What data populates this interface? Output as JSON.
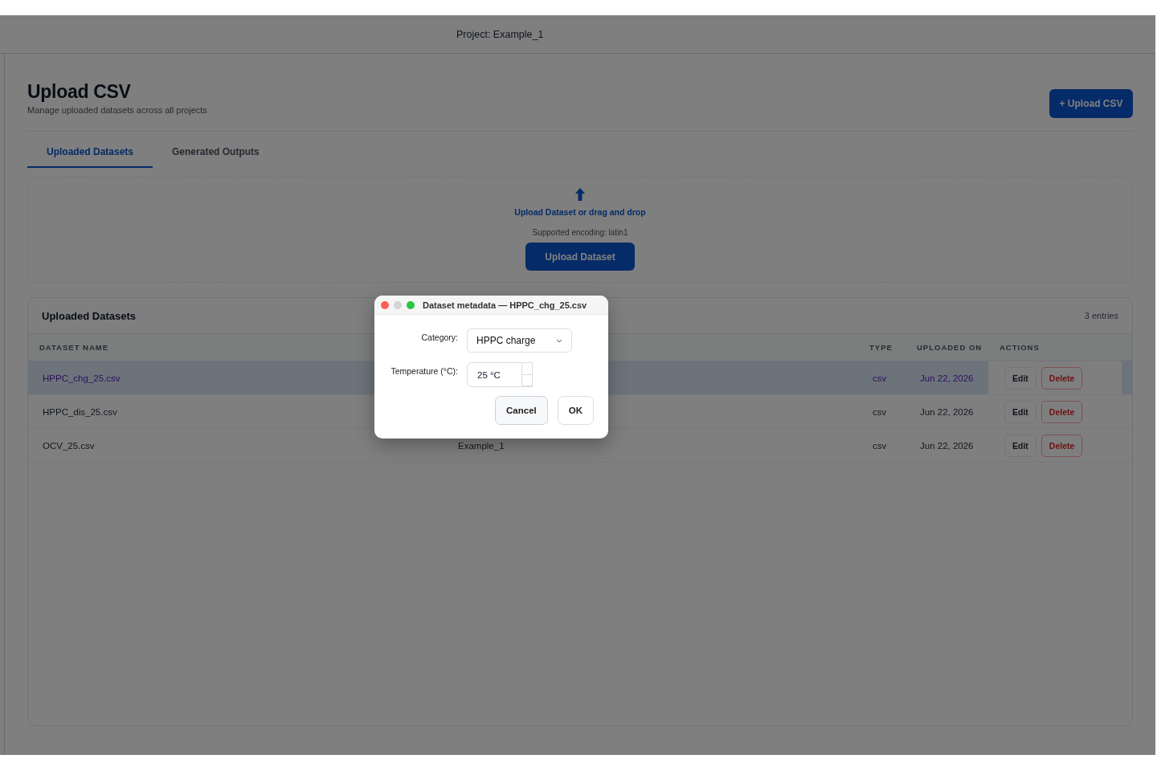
{
  "header": {
    "project_label": "Project: Example_1"
  },
  "page": {
    "title": "Upload CSV",
    "subtitle": "Manage uploaded datasets across all projects",
    "upload_button": "+ Upload CSV"
  },
  "tabs": [
    {
      "label": "Uploaded Datasets",
      "selected": true
    },
    {
      "label": "Generated Outputs",
      "selected": false
    }
  ],
  "dropzone": {
    "link": "Upload Dataset or drag and drop",
    "note": "Supported encoding: latin1",
    "button": "Upload Dataset"
  },
  "table": {
    "title": "Uploaded Datasets",
    "count": "3 entries",
    "columns": [
      "DATASET NAME",
      "TYPE",
      "UPLOADED ON",
      "ACTIONS"
    ],
    "rows": [
      {
        "name": "HPPC_chg_25.csv",
        "type": "csv",
        "uploaded_on": "Jun 22, 2026",
        "selected": true,
        "actions": [
          {
            "kind": "edit",
            "label": "Edit"
          },
          {
            "kind": "delete",
            "label": "Delete"
          }
        ]
      },
      {
        "name": "HPPC_dis_25.csv",
        "type": "csv",
        "uploaded_on": "Jun 22, 2026",
        "selected": false,
        "actions": [
          {
            "kind": "edit",
            "label": "Edit"
          },
          {
            "kind": "delete",
            "label": "Delete"
          }
        ]
      },
      {
        "name": "OCV_25.csv",
        "project": "Example_1",
        "type": "csv",
        "uploaded_on": "Jun 22, 2026",
        "selected": false,
        "actions": [
          {
            "kind": "edit",
            "label": "Edit"
          },
          {
            "kind": "delete",
            "label": "Delete"
          }
        ]
      }
    ]
  },
  "dialog": {
    "title": "Dataset metadata — HPPC_chg_25.csv",
    "fields": [
      {
        "kind": "select",
        "label": "Category:",
        "value": "HPPC charge"
      },
      {
        "kind": "spin",
        "label": "Temperature (°C):",
        "value": "25 °C"
      }
    ],
    "buttons": [
      {
        "label": "Cancel",
        "focused": true
      },
      {
        "label": "OK",
        "focused": false
      }
    ]
  }
}
